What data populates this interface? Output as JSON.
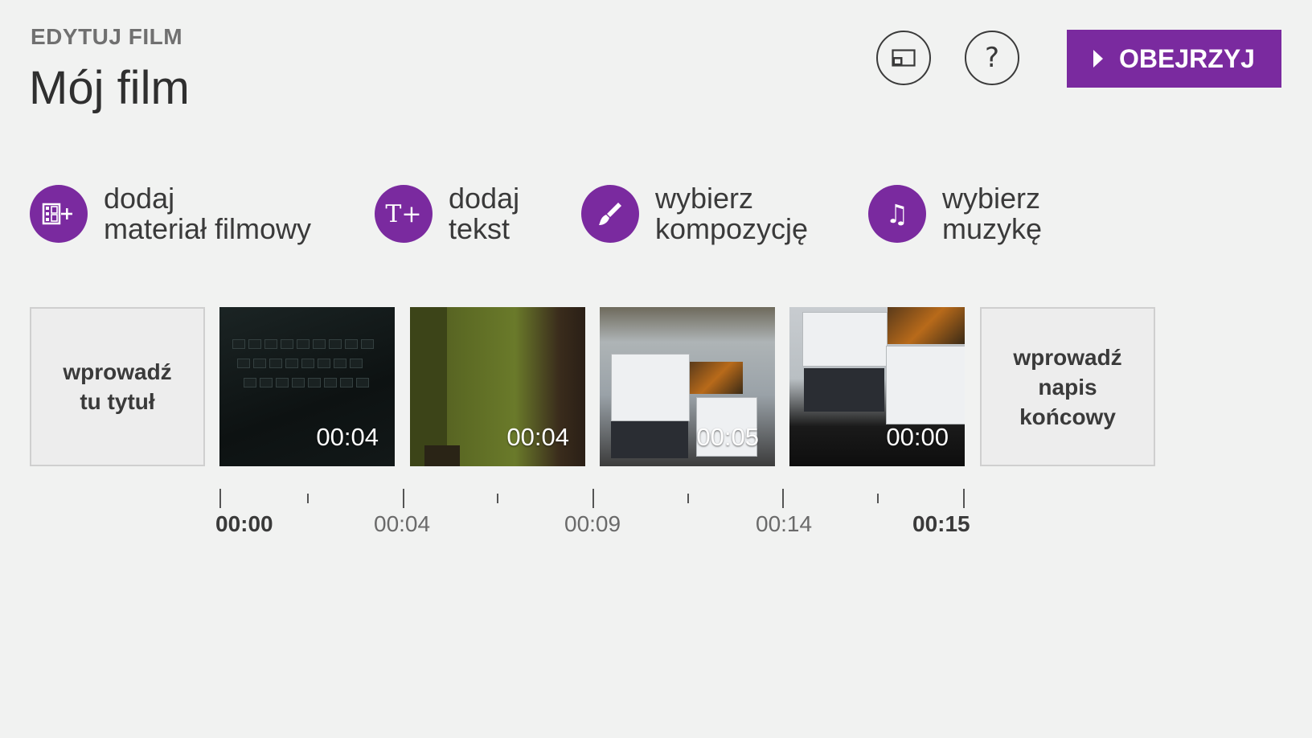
{
  "header": {
    "subtitle": "EDYTUJ FILM",
    "title": "Mój film",
    "cast_icon": "cast-screen-icon",
    "help_label": "?",
    "watch_label": "OBEJRZYJ",
    "accent_color": "#7a2a9f"
  },
  "actions": [
    {
      "line1": "dodaj",
      "line2": "materiał filmowy",
      "icon": "add-video-icon"
    },
    {
      "line1": "dodaj",
      "line2": "tekst",
      "icon": "add-text-icon",
      "glyph": "T+"
    },
    {
      "line1": "wybierz",
      "line2": "kompozycję",
      "icon": "paint-brush-icon"
    },
    {
      "line1": "wybierz",
      "line2": "muzykę",
      "icon": "music-note-icon",
      "glyph": "♫"
    }
  ],
  "timeline": {
    "title_tile": {
      "line1": "wprowadź",
      "line2": "tu tytuł"
    },
    "end_tile": {
      "line1": "wprowadź",
      "line2": "napis",
      "line3": "końcowy"
    },
    "clips": [
      {
        "duration": "00:04"
      },
      {
        "duration": "00:04"
      },
      {
        "duration": "00:05"
      },
      {
        "duration": "00:00"
      }
    ],
    "ruler": [
      "00:00",
      "00:04",
      "00:09",
      "00:14",
      "00:15"
    ]
  }
}
